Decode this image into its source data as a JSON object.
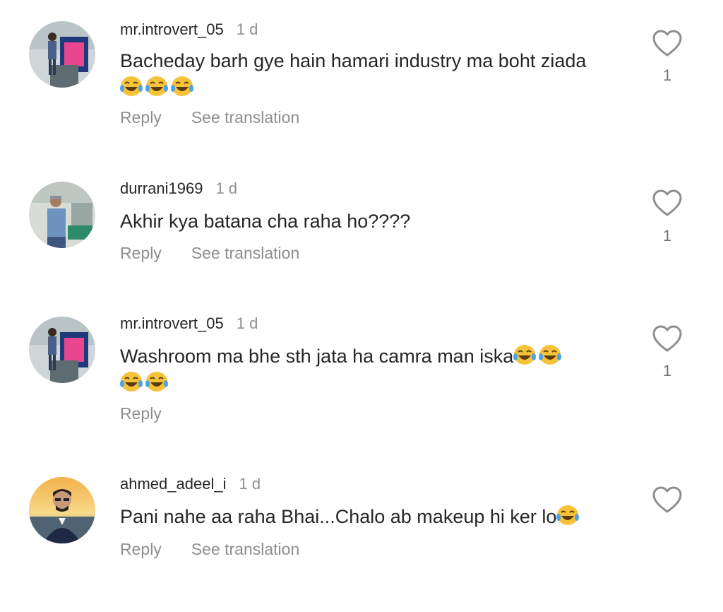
{
  "comments": [
    {
      "username": "mr.introvert_05",
      "time": "1 d",
      "text": "Bacheday barh gye hain hamari industry ma boht ziada",
      "emojis": [
        "😂",
        "😂",
        "😂"
      ],
      "likes": "1",
      "reply_label": "Reply",
      "translate_label": "See translation"
    },
    {
      "username": "durrani1969",
      "time": "1 d",
      "text": "Akhir kya batana  cha raha ho????",
      "likes": "1",
      "reply_label": "Reply",
      "translate_label": "See translation"
    },
    {
      "username": "mr.introvert_05",
      "time": "1 d",
      "text": "Washroom ma bhe sth jata ha camra man iska",
      "emojis_inline": [
        "😂",
        "😂"
      ],
      "emojis_line2": [
        "😂",
        "😂"
      ],
      "likes": "1",
      "reply_label": "Reply"
    },
    {
      "username": "ahmed_adeel_i",
      "time": "1 d",
      "text": "Pani nahe aa raha Bhai...Chalo ab makeup hi ker lo",
      "emojis_inline": [
        "😂"
      ],
      "reply_label": "Reply",
      "translate_label": "See translation"
    }
  ],
  "colors": {
    "text": "#262626",
    "secondary": "#8e8e8e",
    "emoji": "#f6c23a"
  },
  "icons": [
    "heart-outline-icon",
    "laughing-tears-emoji"
  ]
}
